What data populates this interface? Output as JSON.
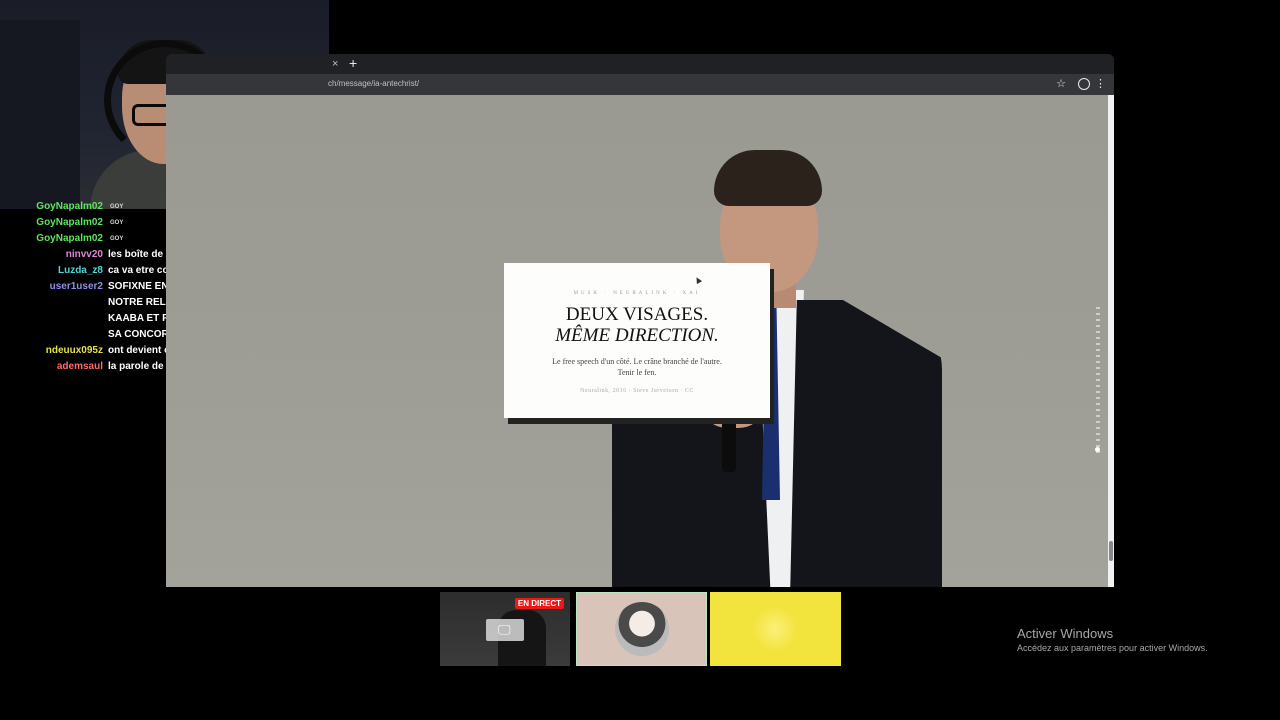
{
  "browser": {
    "url": "ch/message/ia-antechrist/",
    "tab_close_icon": "×",
    "new_tab_icon": "+",
    "star_icon": "☆",
    "kebab_icon": "⋮"
  },
  "card": {
    "tags": "MUSK · NEURALINK · XAI",
    "title_line1": "DEUX VISAGES.",
    "title_line2": "MÊME DIRECTION.",
    "description": "Le free speech d'un côté. Le crâne branché de l'autre. Tenir le fen.",
    "credit": "Neuralink, 2016 · Steve Jurvetson · CC"
  },
  "chat": {
    "messages": [
      {
        "user": "GoyNapalm02",
        "badge": "GOY",
        "text": "",
        "color": "#5ee35e"
      },
      {
        "user": "GoyNapalm02",
        "badge": "GOY",
        "text": "",
        "color": "#5ee35e"
      },
      {
        "user": "GoyNapalm02",
        "badge": "GOY",
        "text": "",
        "color": "#5ee35e"
      },
      {
        "user": "ninvv20",
        "badge": "",
        "text": "les boîte de nuit en Arabie saoudite déjà",
        "color": "#d88ad8"
      },
      {
        "user": "Luzda_z8",
        "badge": "",
        "text": "ca va etre compliqué",
        "color": "#4fd6d6"
      },
      {
        "user": "user1user2",
        "badge": "",
        "text": "SOFIXNE EN ISLAM TELLEMENT ON SERA LOIN DE NOTRE RELIGION UN HOMME DETRUIRA LA KAABA ET PERSONNE VA REAGIR ET EN PARLER SA CONCORDE",
        "color": "#8f8fe8"
      },
      {
        "user": "ndeuux095z",
        "badge": "",
        "text": "ont devient éveiller d'où le chat control",
        "color": "#e2e24a"
      },
      {
        "user": "ademsaul",
        "badge": "",
        "text": "la parole de dieu va jamais tomber les frère",
        "color": "#ff6b6b"
      }
    ]
  },
  "thumbnails": {
    "live_label": "EN DIRECT",
    "screen_icon": "🖵"
  },
  "watermark": {
    "title": "Activer Windows",
    "subtitle": "Accédez aux paramètres pour activer Windows."
  }
}
